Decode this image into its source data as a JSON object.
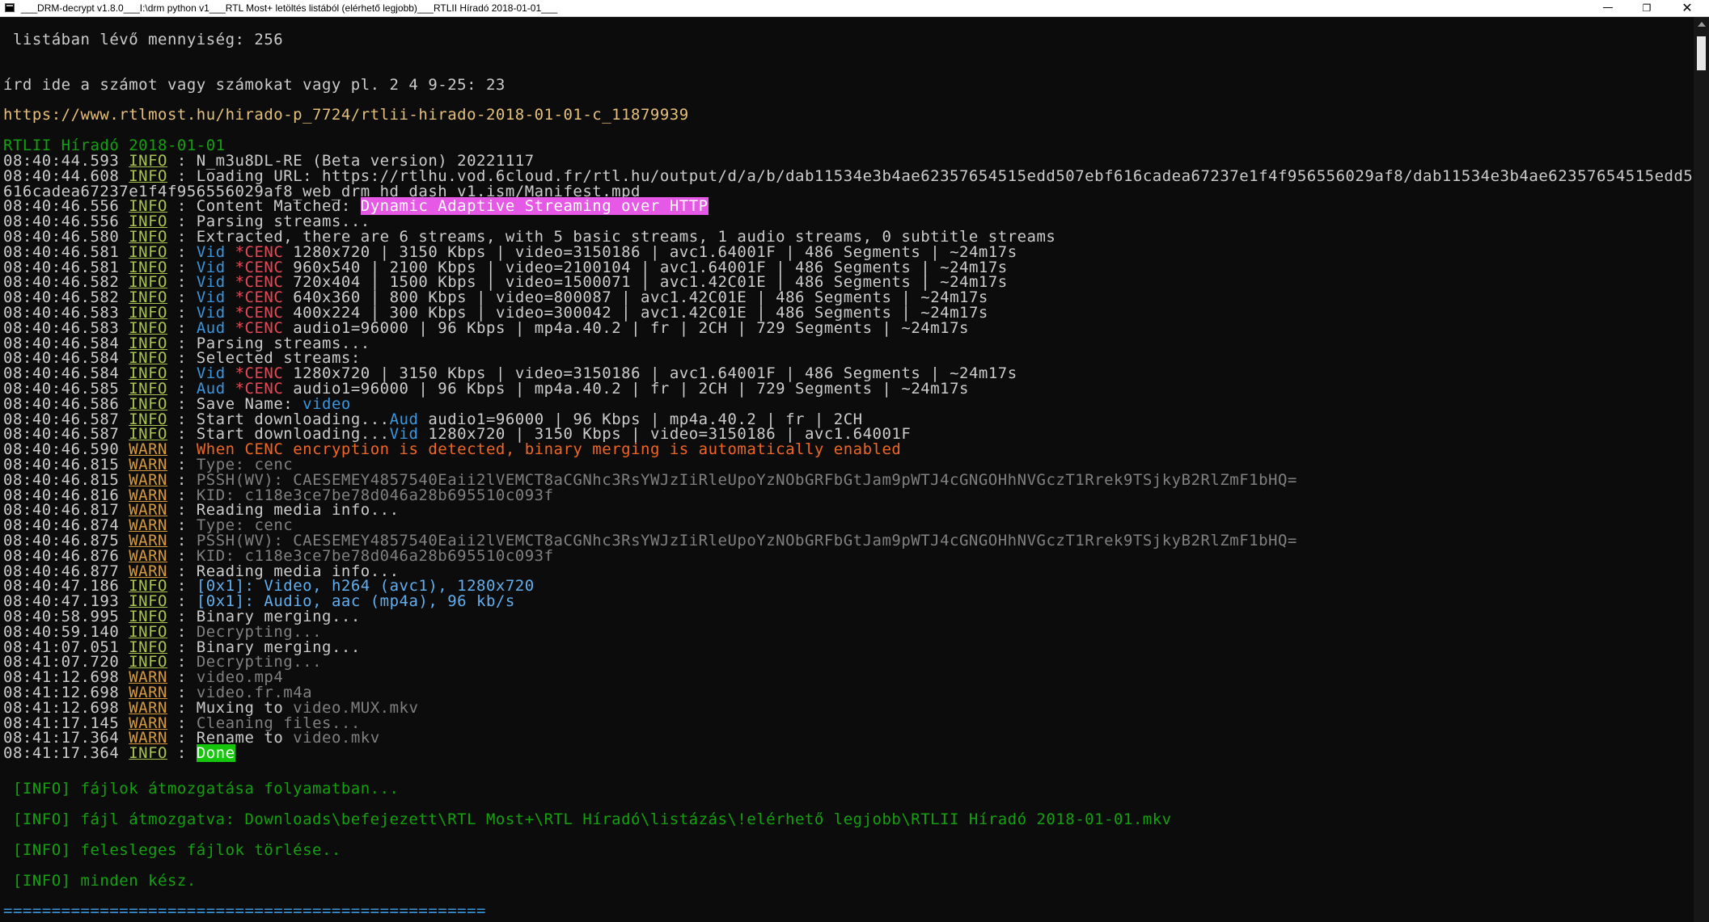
{
  "window": {
    "title": "___DRM-decrypt v1.8.0___I:\\drm python v1___RTL Most+ letöltés listából (elérhető legjobb)___RTLII Híradó 2018-01-01___",
    "minimize": "—",
    "maximize": "❐",
    "close": "✕"
  },
  "top": {
    "count_line": " listában lévő mennyiség: 256",
    "prompt_line": "írd ide a számot vagy számokat vagy pl. 2 4 9-25: 23",
    "url": "https://www.rtlmost.hu/hirado-p_7724/rtlii-hirado-2018-01-01-c_11879939",
    "episode": "RTLII Híradó 2018-01-01"
  },
  "log": [
    {
      "t": "08:40:44.593",
      "l": "INFO",
      "p": [
        {
          "c": "w",
          "x": " : N_m3u8DL-RE (Beta version) 20221117"
        }
      ]
    },
    {
      "t": "08:40:44.608",
      "l": "INFO",
      "p": [
        {
          "c": "w",
          "x": " : Loading URL: https://rtlhu.vod.6cloud.fr/rtl.hu/output/d/a/b/dab11534e3b4ae62357654515edd507ebf616cadea67237e1f4f956556029af8/dab11534e3b4ae62357654515edd507ebf"
        }
      ]
    },
    {
      "t": "",
      "l": "",
      "p": [
        {
          "c": "w",
          "x": "616cadea67237e1f4f956556029af8_web_drm_hd_dash_v1.ism/Manifest.mpd"
        }
      ]
    },
    {
      "t": "08:40:46.556",
      "l": "INFO",
      "p": [
        {
          "c": "w",
          "x": " : Content Matched: "
        },
        {
          "c": "mag",
          "x": "Dynamic Adaptive Streaming over HTTP"
        }
      ]
    },
    {
      "t": "08:40:46.556",
      "l": "INFO",
      "p": [
        {
          "c": "w",
          "x": " : Parsing streams..."
        }
      ]
    },
    {
      "t": "08:40:46.580",
      "l": "INFO",
      "p": [
        {
          "c": "w",
          "x": " : Extracted, there are 6 streams, with 5 basic streams, 1 audio streams, 0 subtitle streams"
        }
      ]
    },
    {
      "t": "08:40:46.581",
      "l": "INFO",
      "p": [
        {
          "c": "w",
          "x": " : "
        },
        {
          "c": "cyan",
          "x": "Vid"
        },
        {
          "c": "red",
          "x": " *CENC"
        },
        {
          "c": "w",
          "x": " 1280x720 | 3150 Kbps | video=3150186 | avc1.64001F | 486 Segments | ~24m17s"
        }
      ]
    },
    {
      "t": "08:40:46.581",
      "l": "INFO",
      "p": [
        {
          "c": "w",
          "x": " : "
        },
        {
          "c": "cyan",
          "x": "Vid"
        },
        {
          "c": "red",
          "x": " *CENC"
        },
        {
          "c": "w",
          "x": " 960x540 | 2100 Kbps | video=2100104 | avc1.64001F | 486 Segments | ~24m17s"
        }
      ]
    },
    {
      "t": "08:40:46.582",
      "l": "INFO",
      "p": [
        {
          "c": "w",
          "x": " : "
        },
        {
          "c": "cyan",
          "x": "Vid"
        },
        {
          "c": "red",
          "x": " *CENC"
        },
        {
          "c": "w",
          "x": " 720x404 | 1500 Kbps | video=1500071 | avc1.42C01E | 486 Segments | ~24m17s"
        }
      ]
    },
    {
      "t": "08:40:46.582",
      "l": "INFO",
      "p": [
        {
          "c": "w",
          "x": " : "
        },
        {
          "c": "cyan",
          "x": "Vid"
        },
        {
          "c": "red",
          "x": " *CENC"
        },
        {
          "c": "w",
          "x": " 640x360 | 800 Kbps | video=800087 | avc1.42C01E | 486 Segments | ~24m17s"
        }
      ]
    },
    {
      "t": "08:40:46.583",
      "l": "INFO",
      "p": [
        {
          "c": "w",
          "x": " : "
        },
        {
          "c": "cyan",
          "x": "Vid"
        },
        {
          "c": "red",
          "x": " *CENC"
        },
        {
          "c": "w",
          "x": " 400x224 | 300 Kbps | video=300042 | avc1.42C01E | 486 Segments | ~24m17s"
        }
      ]
    },
    {
      "t": "08:40:46.583",
      "l": "INFO",
      "p": [
        {
          "c": "w",
          "x": " : "
        },
        {
          "c": "cyan",
          "x": "Aud"
        },
        {
          "c": "red",
          "x": " *CENC"
        },
        {
          "c": "w",
          "x": " audio1=96000 | 96 Kbps | mp4a.40.2 | fr | 2CH | 729 Segments | ~24m17s"
        }
      ]
    },
    {
      "t": "08:40:46.584",
      "l": "INFO",
      "p": [
        {
          "c": "w",
          "x": " : Parsing streams..."
        }
      ]
    },
    {
      "t": "08:40:46.584",
      "l": "INFO",
      "p": [
        {
          "c": "w",
          "x": " : Selected streams:"
        }
      ]
    },
    {
      "t": "08:40:46.584",
      "l": "INFO",
      "p": [
        {
          "c": "w",
          "x": " : "
        },
        {
          "c": "cyan",
          "x": "Vid"
        },
        {
          "c": "red",
          "x": " *CENC"
        },
        {
          "c": "w",
          "x": " 1280x720 | 3150 Kbps | video=3150186 | avc1.64001F | 486 Segments | ~24m17s"
        }
      ]
    },
    {
      "t": "08:40:46.585",
      "l": "INFO",
      "p": [
        {
          "c": "w",
          "x": " : "
        },
        {
          "c": "cyan",
          "x": "Aud"
        },
        {
          "c": "red",
          "x": " *CENC"
        },
        {
          "c": "w",
          "x": " audio1=96000 | 96 Kbps | mp4a.40.2 | fr | 2CH | 729 Segments | ~24m17s"
        }
      ]
    },
    {
      "t": "08:40:46.586",
      "l": "INFO",
      "p": [
        {
          "c": "w",
          "x": " : Save Name: "
        },
        {
          "c": "cyan",
          "x": "video"
        }
      ]
    },
    {
      "t": "08:40:46.587",
      "l": "INFO",
      "p": [
        {
          "c": "w",
          "x": " : Start downloading..."
        },
        {
          "c": "cyan",
          "x": "Aud"
        },
        {
          "c": "w",
          "x": " audio1=96000 | 96 Kbps | mp4a.40.2 | fr | 2CH"
        }
      ]
    },
    {
      "t": "08:40:46.587",
      "l": "INFO",
      "p": [
        {
          "c": "w",
          "x": " : Start downloading..."
        },
        {
          "c": "cyan",
          "x": "Vid"
        },
        {
          "c": "w",
          "x": " 1280x720 | 3150 Kbps | video=3150186 | avc1.64001F"
        }
      ]
    },
    {
      "t": "08:40:46.590",
      "l": "WARN",
      "p": [
        {
          "c": "w",
          "x": " : "
        },
        {
          "c": "orange",
          "x": "When CENC encryption is detected, binary merging is automatically enabled"
        }
      ]
    },
    {
      "t": "08:40:46.815",
      "l": "WARN",
      "p": [
        {
          "c": "w",
          "x": " : "
        },
        {
          "c": "gray",
          "x": "Type: cenc"
        }
      ]
    },
    {
      "t": "08:40:46.815",
      "l": "WARN",
      "p": [
        {
          "c": "w",
          "x": " : "
        },
        {
          "c": "gray",
          "x": "PSSH(WV): CAESEMEY4857540Eaii2lVEMCT8aCGNhc3RsYWJzIiRleUpoYzNObGRFbGtJam9pWTJ4cGNGOHhNVGczT1Rrek9TSjkyB2RlZmF1bHQ="
        }
      ]
    },
    {
      "t": "08:40:46.816",
      "l": "WARN",
      "p": [
        {
          "c": "w",
          "x": " : "
        },
        {
          "c": "gray",
          "x": "KID: c118e3ce7be78d046a28b695510c093f"
        }
      ]
    },
    {
      "t": "08:40:46.817",
      "l": "WARN",
      "p": [
        {
          "c": "w",
          "x": " : Reading media info..."
        }
      ]
    },
    {
      "t": "08:40:46.874",
      "l": "WARN",
      "p": [
        {
          "c": "w",
          "x": " : "
        },
        {
          "c": "gray",
          "x": "Type: cenc"
        }
      ]
    },
    {
      "t": "08:40:46.875",
      "l": "WARN",
      "p": [
        {
          "c": "w",
          "x": " : "
        },
        {
          "c": "gray",
          "x": "PSSH(WV): CAESEMEY4857540Eaii2lVEMCT8aCGNhc3RsYWJzIiRleUpoYzNObGRFbGtJam9pWTJ4cGNGOHhNVGczT1Rrek9TSjkyB2RlZmF1bHQ="
        }
      ]
    },
    {
      "t": "08:40:46.876",
      "l": "WARN",
      "p": [
        {
          "c": "w",
          "x": " : "
        },
        {
          "c": "gray",
          "x": "KID: c118e3ce7be78d046a28b695510c093f"
        }
      ]
    },
    {
      "t": "08:40:46.877",
      "l": "WARN",
      "p": [
        {
          "c": "w",
          "x": " : Reading media info..."
        }
      ]
    },
    {
      "t": "08:40:47.186",
      "l": "INFO",
      "p": [
        {
          "c": "w",
          "x": " : "
        },
        {
          "c": "lblue",
          "x": "[0x1]: Video, h264 (avc1), 1280x720"
        }
      ]
    },
    {
      "t": "08:40:47.193",
      "l": "INFO",
      "p": [
        {
          "c": "w",
          "x": " : "
        },
        {
          "c": "lblue",
          "x": "[0x1]: Audio, aac (mp4a), 96 kb/s"
        }
      ]
    },
    {
      "t": "08:40:58.995",
      "l": "INFO",
      "p": [
        {
          "c": "w",
          "x": " : Binary merging..."
        }
      ]
    },
    {
      "t": "08:40:59.140",
      "l": "INFO",
      "p": [
        {
          "c": "w",
          "x": " : "
        },
        {
          "c": "gray",
          "x": "Decrypting..."
        }
      ]
    },
    {
      "t": "08:41:07.051",
      "l": "INFO",
      "p": [
        {
          "c": "w",
          "x": " : Binary merging..."
        }
      ]
    },
    {
      "t": "08:41:07.720",
      "l": "INFO",
      "p": [
        {
          "c": "w",
          "x": " : "
        },
        {
          "c": "gray",
          "x": "Decrypting..."
        }
      ]
    },
    {
      "t": "08:41:12.698",
      "l": "WARN",
      "p": [
        {
          "c": "w",
          "x": " : "
        },
        {
          "c": "gray",
          "x": "video.mp4"
        }
      ]
    },
    {
      "t": "08:41:12.698",
      "l": "WARN",
      "p": [
        {
          "c": "w",
          "x": " : "
        },
        {
          "c": "gray",
          "x": "video.fr.m4a"
        }
      ]
    },
    {
      "t": "08:41:12.698",
      "l": "WARN",
      "p": [
        {
          "c": "w",
          "x": " : Muxing to "
        },
        {
          "c": "gray",
          "x": "video.MUX.mkv"
        }
      ]
    },
    {
      "t": "08:41:17.145",
      "l": "WARN",
      "p": [
        {
          "c": "w",
          "x": " : "
        },
        {
          "c": "gray",
          "x": "Cleaning files..."
        }
      ]
    },
    {
      "t": "08:41:17.364",
      "l": "WARN",
      "p": [
        {
          "c": "w",
          "x": " : Rename to "
        },
        {
          "c": "gray",
          "x": "video.mkv"
        }
      ]
    },
    {
      "t": "08:41:17.364",
      "l": "INFO",
      "p": [
        {
          "c": "w",
          "x": " : "
        },
        {
          "c": "done",
          "x": "Done"
        }
      ]
    }
  ],
  "bottom": {
    "moving": " [INFO] fájlok átmozgatása folyamatban...",
    "moved": " [INFO] fájl átmozgatva: Downloads\\befejezett\\RTL Most+\\RTL Híradó\\listázás\\!elérhető legjobb\\RTLII Híradó 2018-01-01.mkv",
    "deleting": " [INFO] felesleges fájlok törlése..",
    "ready": " [INFO] minden kész.",
    "separator": "=================================================="
  },
  "colors": {
    "background": "#0c0c0c",
    "text": "#cccccc",
    "url": "#e5c07b",
    "green": "#13a10e",
    "info": "#a9c34f",
    "warn": "#d79a3a",
    "cyan": "#3a96dd",
    "red": "#e74856",
    "orange": "#f06622",
    "magenta": "#e659e6",
    "done": "#16c60c"
  }
}
